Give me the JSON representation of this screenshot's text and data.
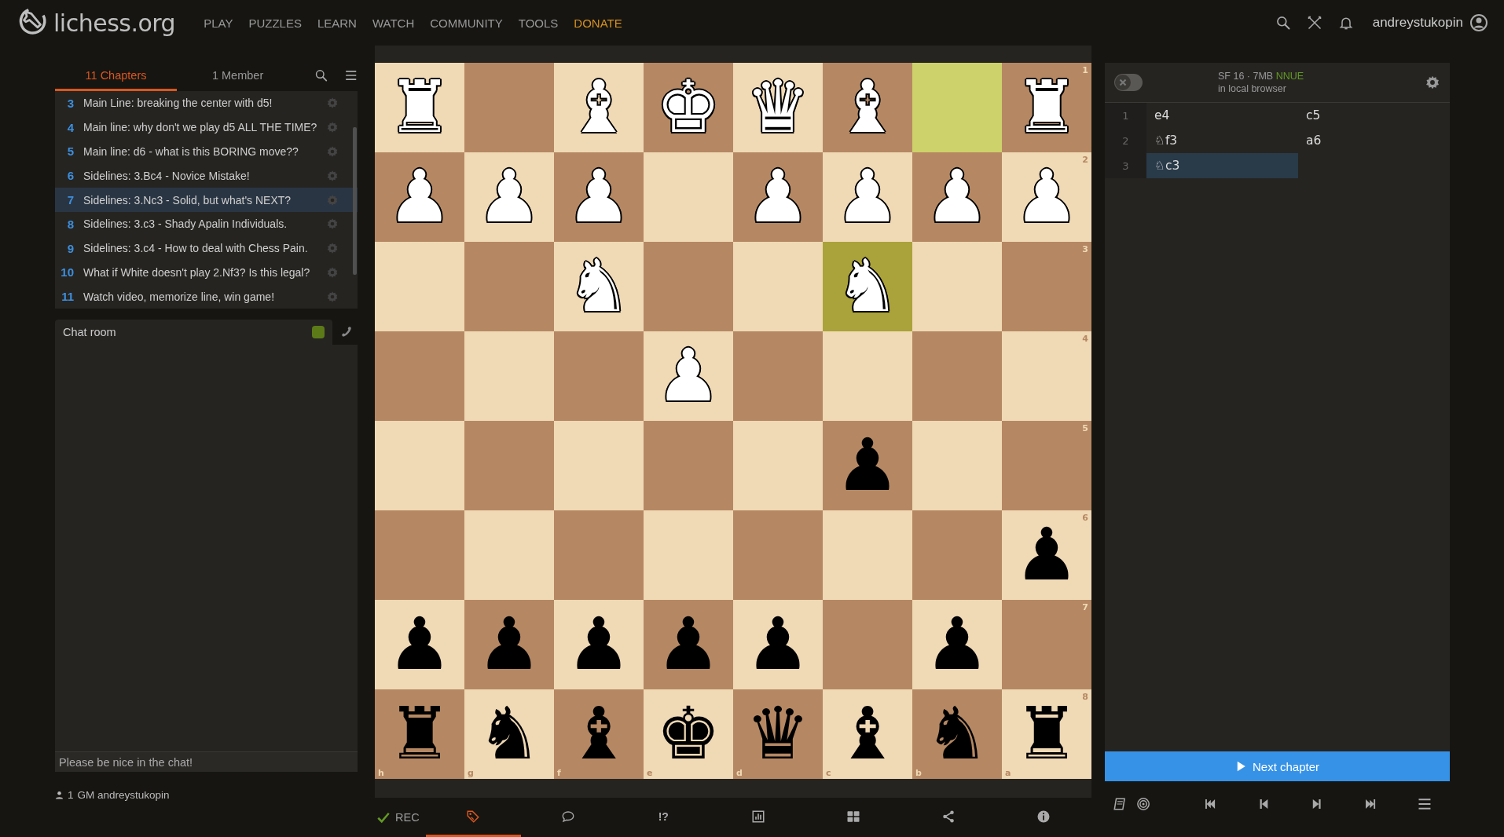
{
  "topbar": {
    "logo": "lichess.org",
    "nav": [
      {
        "label": "PLAY",
        "kind": "normal"
      },
      {
        "label": "PUZZLES",
        "kind": "normal"
      },
      {
        "label": "LEARN",
        "kind": "normal"
      },
      {
        "label": "WATCH",
        "kind": "normal"
      },
      {
        "label": "COMMUNITY",
        "kind": "normal"
      },
      {
        "label": "TOOLS",
        "kind": "normal"
      },
      {
        "label": "DONATE",
        "kind": "donate"
      }
    ],
    "username": "andreystukopin"
  },
  "study": {
    "tabs": [
      {
        "label": "11 Chapters",
        "selected": true
      },
      {
        "label": "1 Member",
        "selected": false
      }
    ],
    "chapters": [
      {
        "number": "3",
        "title": "Main Line: breaking the center with d5!",
        "selected": false
      },
      {
        "number": "4",
        "title": "Main line: why don't we play d5 ALL THE TIME?",
        "selected": false
      },
      {
        "number": "5",
        "title": "Main line: d6 - what is this BORING move??",
        "selected": false
      },
      {
        "number": "6",
        "title": "Sidelines: 3.Bc4 - Novice Mistake!",
        "selected": false
      },
      {
        "number": "7",
        "title": "Sidelines: 3.Nc3 - Solid, but what's NEXT?",
        "selected": true
      },
      {
        "number": "8",
        "title": "Sidelines: 3.c3 - Shady Apalin Individuals.",
        "selected": false
      },
      {
        "number": "9",
        "title": "Sidelines: 3.c4 - How to deal with Chess Pain.",
        "selected": false
      },
      {
        "number": "10",
        "title": "What if White doesn't play 2.Nf3? Is this legal?",
        "selected": false
      },
      {
        "number": "11",
        "title": "Watch video, memorize line, win game!",
        "selected": false
      }
    ],
    "chat": {
      "title": "Chat room",
      "enabled": true,
      "placeholder": "Please be nice in the chat!"
    },
    "members": {
      "count": "1",
      "name": "GM andreystukopin"
    }
  },
  "board": {
    "ranks": [
      {
        "label": "1",
        "squares": [
          {
            "piece": "♜",
            "white": true,
            "highlighted": false
          },
          {
            "highlighted": false
          },
          {
            "piece": "♝",
            "white": true,
            "highlighted": false
          },
          {
            "piece": "♚",
            "white": true,
            "highlighted": false
          },
          {
            "piece": "♛",
            "white": true,
            "highlighted": false
          },
          {
            "piece": "♝",
            "white": true,
            "highlighted": false
          },
          {
            "highlighted": true
          },
          {
            "piece": "♜",
            "white": true,
            "highlighted": false
          }
        ]
      },
      {
        "label": "2",
        "squares": [
          {
            "piece": "♟",
            "white": true,
            "highlighted": false
          },
          {
            "piece": "♟",
            "white": true,
            "highlighted": false
          },
          {
            "piece": "♟",
            "white": true,
            "highlighted": false
          },
          {
            "highlighted": false
          },
          {
            "piece": "♟",
            "white": true,
            "highlighted": false
          },
          {
            "piece": "♟",
            "white": true,
            "highlighted": false
          },
          {
            "piece": "♟",
            "white": true,
            "highlighted": false
          },
          {
            "piece": "♟",
            "white": true,
            "highlighted": false
          }
        ]
      },
      {
        "label": "3",
        "squares": [
          {
            "highlighted": false
          },
          {
            "highlighted": false
          },
          {
            "piece": "♞",
            "white": true,
            "highlighted": false
          },
          {
            "highlighted": false
          },
          {
            "highlighted": false
          },
          {
            "piece": "♞",
            "white": true,
            "highlighted": true
          },
          {
            "highlighted": false
          },
          {
            "highlighted": false
          }
        ]
      },
      {
        "label": "4",
        "squares": [
          {
            "highlighted": false
          },
          {
            "highlighted": false
          },
          {
            "highlighted": false
          },
          {
            "piece": "♟",
            "white": true,
            "highlighted": false
          },
          {
            "highlighted": false
          },
          {
            "highlighted": false
          },
          {
            "highlighted": false
          },
          {
            "highlighted": false
          }
        ]
      },
      {
        "label": "5",
        "squares": [
          {
            "highlighted": false
          },
          {
            "highlighted": false
          },
          {
            "highlighted": false
          },
          {
            "highlighted": false
          },
          {
            "highlighted": false
          },
          {
            "piece": "♟",
            "white": false,
            "highlighted": false
          },
          {
            "highlighted": false
          },
          {
            "highlighted": false
          }
        ]
      },
      {
        "label": "6",
        "squares": [
          {
            "highlighted": false
          },
          {
            "highlighted": false
          },
          {
            "highlighted": false
          },
          {
            "highlighted": false
          },
          {
            "highlighted": false
          },
          {
            "highlighted": false
          },
          {
            "highlighted": false
          },
          {
            "piece": "♟",
            "white": false,
            "highlighted": false
          }
        ]
      },
      {
        "label": "7",
        "squares": [
          {
            "piece": "♟",
            "white": false,
            "highlighted": false
          },
          {
            "piece": "♟",
            "white": false,
            "highlighted": false
          },
          {
            "piece": "♟",
            "white": false,
            "highlighted": false
          },
          {
            "piece": "♟",
            "white": false,
            "highlighted": false
          },
          {
            "piece": "♟",
            "white": false,
            "highlighted": false
          },
          {
            "highlighted": false
          },
          {
            "piece": "♟",
            "white": false,
            "highlighted": false
          },
          {
            "highlighted": false
          }
        ]
      },
      {
        "label": "8",
        "squares": [
          {
            "piece": "♜",
            "white": false,
            "highlighted": false
          },
          {
            "piece": "♞",
            "white": false,
            "highlighted": false
          },
          {
            "piece": "♝",
            "white": false,
            "highlighted": false
          },
          {
            "piece": "♚",
            "white": false,
            "highlighted": false
          },
          {
            "piece": "♛",
            "white": false,
            "highlighted": false
          },
          {
            "piece": "♝",
            "white": false,
            "highlighted": false
          },
          {
            "piece": "♞",
            "white": false,
            "highlighted": false
          },
          {
            "piece": "♜",
            "white": false,
            "highlighted": false
          }
        ]
      }
    ],
    "files": [
      "h",
      "g",
      "f",
      "e",
      "d",
      "c",
      "b",
      "a"
    ]
  },
  "tools": {
    "rec_label": "REC",
    "recording": true,
    "tabs": [
      {
        "kind": "tags",
        "selected": true
      },
      {
        "kind": "comments",
        "selected": false
      },
      {
        "kind": "glyphs",
        "label": "!?",
        "selected": false
      },
      {
        "kind": "chart",
        "selected": false
      },
      {
        "kind": "grid",
        "selected": false
      },
      {
        "kind": "share",
        "selected": false
      },
      {
        "kind": "info",
        "selected": false
      }
    ]
  },
  "engine": {
    "on": false,
    "name": "SF 16 · 7MB",
    "badge": "NNUE",
    "location": "in local browser"
  },
  "moves": [
    {
      "number": "1",
      "white": {
        "san": "e4",
        "selected": false
      },
      "black": {
        "san": "c5",
        "selected": false
      }
    },
    {
      "number": "2",
      "white": {
        "san": "♘f3",
        "selected": false
      },
      "black": {
        "san": "a6",
        "selected": false
      }
    },
    {
      "number": "3",
      "white": {
        "san": "♘c3",
        "selected": true
      }
    }
  ],
  "next_chapter": "Next chapter"
}
